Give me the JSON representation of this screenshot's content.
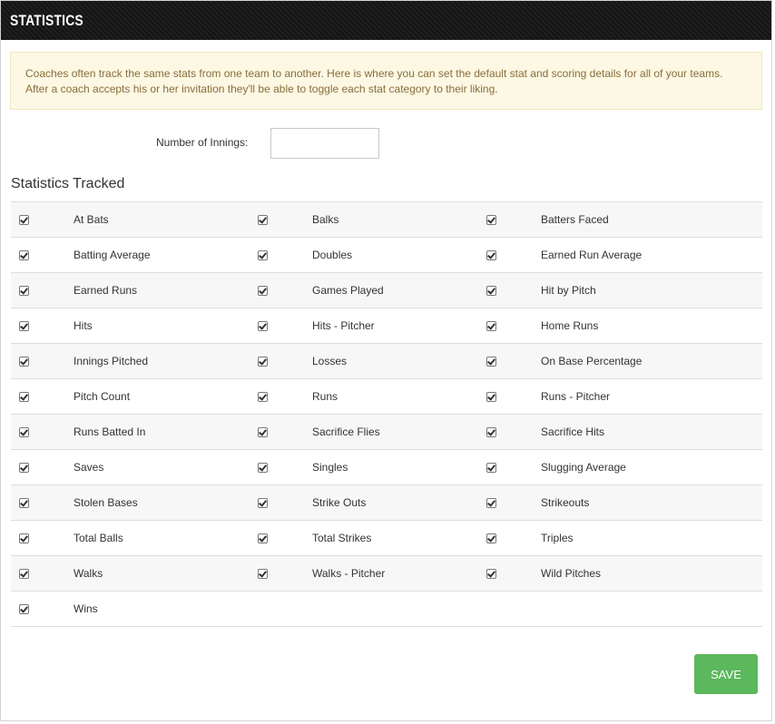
{
  "header": {
    "title": "STATISTICS"
  },
  "notice": {
    "text": "Coaches often track the same stats from one team to another. Here is where you can set the default stat and scoring details for all of your teams. After a coach accepts his or her invitation they'll be able to toggle each stat category to their liking."
  },
  "innings": {
    "label": "Number of Innings:",
    "value": ""
  },
  "section_title": "Statistics Tracked",
  "stats": [
    [
      "At Bats",
      "Balks",
      "Batters Faced"
    ],
    [
      "Batting Average",
      "Doubles",
      "Earned Run Average"
    ],
    [
      "Earned Runs",
      "Games Played",
      "Hit by Pitch"
    ],
    [
      "Hits",
      "Hits - Pitcher",
      "Home Runs"
    ],
    [
      "Innings Pitched",
      "Losses",
      "On Base Percentage"
    ],
    [
      "Pitch Count",
      "Runs",
      "Runs - Pitcher"
    ],
    [
      "Runs Batted In",
      "Sacrifice Flies",
      "Sacrifice Hits"
    ],
    [
      "Saves",
      "Singles",
      "Slugging Average"
    ],
    [
      "Stolen Bases",
      "Strike Outs",
      "Strikeouts"
    ],
    [
      "Total Balls",
      "Total Strikes",
      "Triples"
    ],
    [
      "Walks",
      "Walks - Pitcher",
      "Wild Pitches"
    ],
    [
      "Wins"
    ]
  ],
  "save_label": "SAVE",
  "colors": {
    "save": "#5cb85c",
    "notice_bg": "#fcf8e3",
    "header_bg": "#1a1a1a"
  }
}
